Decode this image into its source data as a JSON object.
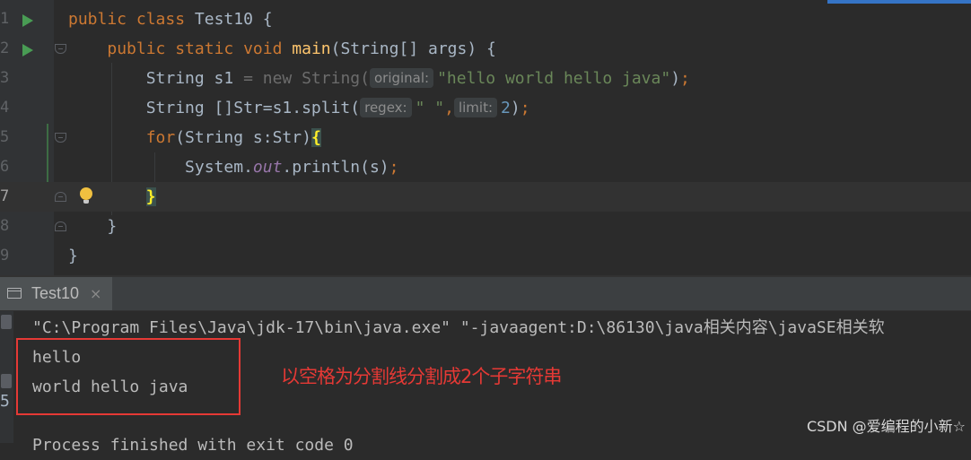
{
  "editor": {
    "lines": [
      {
        "num": "1",
        "parts": [
          [
            "kw",
            "public class "
          ],
          [
            "op",
            "Test10 {"
          ]
        ]
      },
      {
        "num": "2",
        "parts": [
          [
            "op",
            "    "
          ],
          [
            "kw",
            "public static void "
          ],
          [
            "fn",
            "main"
          ],
          [
            "op",
            "(String[] args) {"
          ]
        ]
      },
      {
        "num": "3",
        "parts": [
          [
            "op",
            "        String s1 "
          ],
          [
            "ghost",
            "= new String("
          ],
          [
            "hint",
            "original:"
          ],
          [
            "str",
            "\"hello world hello java\""
          ],
          [
            "op",
            ")"
          ],
          [
            "kw",
            ";"
          ]
        ]
      },
      {
        "num": "4",
        "parts": [
          [
            "op",
            "        String []Str=s1.split("
          ],
          [
            "hint",
            "regex:"
          ],
          [
            "str",
            "\" \""
          ],
          [
            "kw",
            ","
          ],
          [
            "hint",
            "limit:"
          ],
          [
            "num",
            "2"
          ],
          [
            "op",
            ")"
          ],
          [
            "kw",
            ";"
          ]
        ]
      },
      {
        "num": "5",
        "parts": [
          [
            "op",
            "        "
          ],
          [
            "kw",
            "for"
          ],
          [
            "op",
            "(String s:Str)"
          ],
          [
            "brace",
            "{"
          ]
        ]
      },
      {
        "num": "6",
        "parts": [
          [
            "op",
            "            System."
          ],
          [
            "fld",
            "out"
          ],
          [
            "op",
            ".println(s)"
          ],
          [
            "kw",
            ";"
          ]
        ]
      },
      {
        "num": "7",
        "parts": [
          [
            "op",
            "        "
          ],
          [
            "brace",
            "}"
          ]
        ]
      },
      {
        "num": "8",
        "parts": [
          [
            "op",
            "    }"
          ]
        ]
      },
      {
        "num": "9",
        "parts": [
          [
            "op",
            "}"
          ]
        ]
      }
    ]
  },
  "tab": {
    "label": "Test10",
    "close": "×"
  },
  "console": {
    "command": "\"C:\\Program Files\\Java\\jdk-17\\bin\\java.exe\" \"-javaagent:D:\\86130\\java相关内容\\javaSE相关软",
    "output": [
      "hello",
      "world hello java"
    ],
    "exit": "Process finished with exit code 0",
    "gutter_digit": "5"
  },
  "annotation": "以空格为分割线分割成2个子字符串",
  "watermark": "CSDN @爱编程的小新☆",
  "colors": {
    "keyword": "#cc7832",
    "string": "#6a8759",
    "number": "#6897bb",
    "function": "#ffc66d",
    "annotation": "#e53935"
  }
}
